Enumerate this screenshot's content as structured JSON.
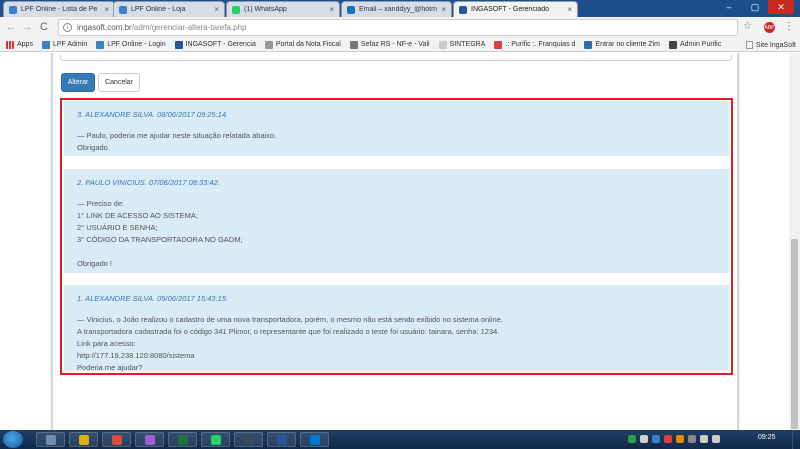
{
  "browser": {
    "tabs": [
      {
        "title": "LPF Online - Lista de Pe",
        "color": "#3b82c4"
      },
      {
        "title": "LPF Online - Loja",
        "color": "#3b82c4"
      },
      {
        "title": "(1) WhatsApp",
        "color": "#25d366"
      },
      {
        "title": "Email – xanddyy_@hotm",
        "color": "#1e6fbf"
      },
      {
        "title": "INGASOFT - Gerenciado",
        "color": "#2a5599",
        "active": true
      }
    ],
    "close_symbol": "×",
    "window_controls": {
      "minimize": "–",
      "maximize": "▢",
      "close": "✕"
    },
    "nav": {
      "back": "←",
      "forward": "→",
      "reload": "C"
    },
    "url": {
      "host": "ingasoft.com.br",
      "path": "/adm/gerenciar-altera-tarefa.php"
    },
    "star": "☆",
    "menu": "⋮",
    "extension_label": "ABP",
    "apps_label": "Apps",
    "bookmarks": [
      {
        "label": "LPF Admin",
        "color": "#3b82c4"
      },
      {
        "label": "LPF Online - Login",
        "color": "#3b82c4"
      },
      {
        "label": "INGASOFT - Gerencia",
        "color": "#2a5599"
      },
      {
        "label": "Portal da Nota Fiscal",
        "color": "#999999"
      },
      {
        "label": "Sefaz RS - NF-e - Vali",
        "color": "#777777"
      },
      {
        "label": "SINTEGRA",
        "color": "#cccccc"
      },
      {
        "label": ".: Purific :. Franquias d",
        "color": "#d94040"
      },
      {
        "label": "Entrar no cliente Zim",
        "color": "#2b6cb0"
      },
      {
        "label": "Admin Purific",
        "color": "#444444"
      }
    ],
    "bookmark_right": "Site IngaSoft"
  },
  "form": {
    "save_label": "Alterar",
    "cancel_label": "Cancelar"
  },
  "history": [
    {
      "header": "3. ALEXANDRE SILVA. 08/06/2017 09:25:14.",
      "lines": [
        "— Paulo, poderia me ajudar neste situação relatada abaixo.",
        "Obrigado."
      ]
    },
    {
      "header": "2. PAULO VINICIUS. 07/06/2017 08:33:42.",
      "lines": [
        "— Preciso de:",
        "1° LINK DE ACESSO AO SISTEMA;",
        "2° USUÁRIO E SENHA;",
        "3° CÓDIGO DA TRANSPORTADORA NO GADM;",
        "",
        "Obrigado !"
      ]
    },
    {
      "header": "1. ALEXANDRE SILVA. 05/06/2017 15:43:15.",
      "lines": [
        "— Vinicius, o João realizou o cadastro de uma nova transportadora, porém, o mesmo não está sendo exibido no sistema online.",
        "A transportadora cadastrada foi o código 341 Plimor, o representante que foi realizado o teste foi usuário: tainara, senha: 1234.",
        "Link para acesso:",
        "http://177.19.238.120:8080/sistema",
        "Poderia me ajudar?"
      ]
    }
  ],
  "taskbar": {
    "apps": [
      {
        "color": "#6f8fb4"
      },
      {
        "color": "#e0b000"
      },
      {
        "color": "#dd4b39"
      },
      {
        "color": "#a060d0"
      },
      {
        "color": "#207245"
      },
      {
        "color": "#25d366"
      },
      {
        "color": "#3a4a5a"
      },
      {
        "color": "#2b579a"
      },
      {
        "color": "#0078d7"
      }
    ],
    "tray_colors": [
      "#2ea043",
      "#d0d0d0",
      "#3b82c4",
      "#e04040",
      "#e08a00",
      "#888888",
      "#cccccc",
      "#cccccc"
    ],
    "clock": "09:25"
  }
}
